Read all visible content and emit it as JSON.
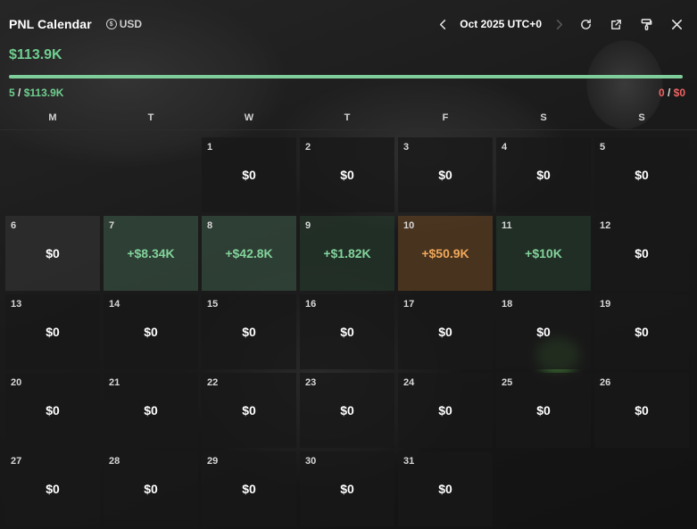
{
  "header": {
    "title": "PNL Calendar",
    "currency": "USD",
    "month_label": "Oct 2025 UTC+0"
  },
  "summary": {
    "total": "$113.9K",
    "win_count": "5",
    "win_total": "$113.9K",
    "loss_count": "0",
    "loss_total": "$0",
    "separator": " / ",
    "win_share": 1.0
  },
  "weekdays": [
    "M",
    "T",
    "W",
    "T",
    "F",
    "S",
    "S"
  ],
  "days": [
    {
      "day": "1",
      "value": "$0"
    },
    {
      "day": "2",
      "value": "$0"
    },
    {
      "day": "3",
      "value": "$0"
    },
    {
      "day": "4",
      "value": "$0"
    },
    {
      "day": "5",
      "value": "$0"
    },
    {
      "day": "6",
      "value": "$0"
    },
    {
      "day": "7",
      "value": "+$8.34K"
    },
    {
      "day": "8",
      "value": "+$42.8K"
    },
    {
      "day": "9",
      "value": "+$1.82K"
    },
    {
      "day": "10",
      "value": "+$50.9K"
    },
    {
      "day": "11",
      "value": "+$10K"
    },
    {
      "day": "12",
      "value": "$0"
    },
    {
      "day": "13",
      "value": "$0"
    },
    {
      "day": "14",
      "value": "$0"
    },
    {
      "day": "15",
      "value": "$0"
    },
    {
      "day": "16",
      "value": "$0"
    },
    {
      "day": "17",
      "value": "$0"
    },
    {
      "day": "18",
      "value": "$0"
    },
    {
      "day": "19",
      "value": "$0"
    },
    {
      "day": "20",
      "value": "$0"
    },
    {
      "day": "21",
      "value": "$0"
    },
    {
      "day": "22",
      "value": "$0"
    },
    {
      "day": "23",
      "value": "$0"
    },
    {
      "day": "24",
      "value": "$0"
    },
    {
      "day": "25",
      "value": "$0"
    },
    {
      "day": "26",
      "value": "$0"
    },
    {
      "day": "27",
      "value": "$0"
    },
    {
      "day": "28",
      "value": "$0"
    },
    {
      "day": "29",
      "value": "$0"
    },
    {
      "day": "30",
      "value": "$0"
    },
    {
      "day": "31",
      "value": "$0"
    }
  ],
  "colors": {
    "profit": "#83d39b",
    "best_day": "#f0a85a",
    "loss": "#f06363",
    "bar": "#7fcd9a"
  },
  "icons": {
    "prev": "chevron-left-icon",
    "next": "chevron-right-icon",
    "refresh": "refresh-icon",
    "share": "external-link-icon",
    "theme": "paint-roller-icon",
    "close": "close-icon",
    "currency": "currency-icon"
  }
}
